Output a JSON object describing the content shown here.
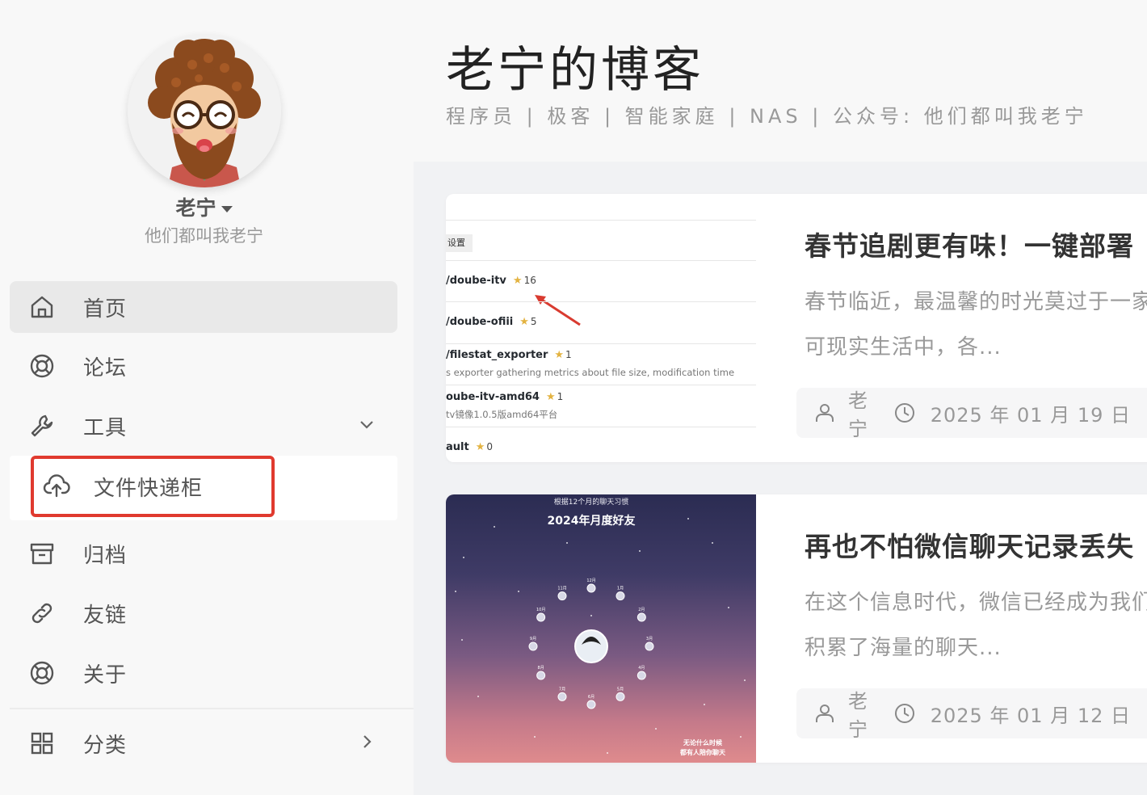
{
  "sidebar": {
    "author_name": "老宁",
    "author_tagline": "他们都叫我老宁",
    "nav": [
      {
        "label": "首页",
        "icon": "home-icon"
      },
      {
        "label": "论坛",
        "icon": "lifebuoy-icon"
      },
      {
        "label": "工具",
        "icon": "wrench-icon"
      },
      {
        "label": "归档",
        "icon": "archive-icon"
      },
      {
        "label": "友链",
        "icon": "link-icon"
      },
      {
        "label": "关于",
        "icon": "lifebuoy-icon"
      },
      {
        "label": "分类",
        "icon": "grid-icon"
      }
    ],
    "submenu": [
      {
        "label": "文件快递柜",
        "icon": "cloud-upload-icon"
      }
    ]
  },
  "header": {
    "title": "老宁的博客",
    "subtitle": "程序员 | 极客 | 智能家庭 | NAS | 公众号: 他们都叫我老宁"
  },
  "posts": [
    {
      "title": "春节追剧更有味！一键部署",
      "excerpt_line1": "春节临近，最温馨的时光莫过于一家",
      "excerpt_line2": "可现实生活中，各...",
      "author": "老宁",
      "date": "2025 年 01 月 19 日",
      "thumb": {
        "tab": "设置",
        "rows": [
          {
            "name": "/doube-itv",
            "stars": "16"
          },
          {
            "name": "/doube-ofiii",
            "stars": "5"
          },
          {
            "name": "/filestat_exporter",
            "stars": "1",
            "desc": "s exporter gathering metrics about file size, modification time"
          },
          {
            "name": "oube-itv-amd64",
            "stars": "1",
            "desc": "tv镜像1.0.5版amd64平台"
          },
          {
            "name": "ault",
            "stars": "0"
          }
        ]
      }
    },
    {
      "title": "再也不怕微信聊天记录丢失",
      "excerpt_line1": "在这个信息时代，微信已经成为我们",
      "excerpt_line2": "积累了海量的聊天...",
      "author": "老宁",
      "date": "2025 年 01 月 12 日",
      "thumb": {
        "caption_top": "根据12个月的聊天习惯",
        "caption_main": "2024年月度好友",
        "caption_foot1": "无论什么时候",
        "caption_foot2": "都有人陪你聊天",
        "months": [
          "1月",
          "2月",
          "3月",
          "4月",
          "5月",
          "6月",
          "7月",
          "8月",
          "9月",
          "10月",
          "11月",
          "12月"
        ]
      }
    }
  ],
  "colors": {
    "accent_box": "#e03a2f",
    "star": "#e3b341",
    "arrow": "#d93b30"
  }
}
